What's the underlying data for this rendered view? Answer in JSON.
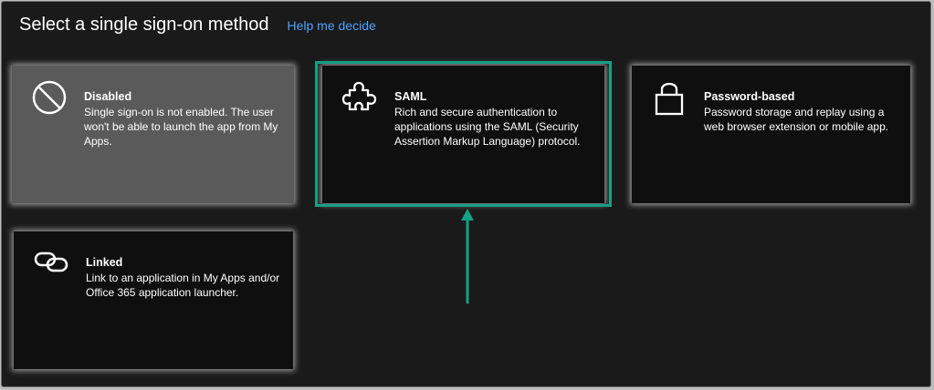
{
  "header": {
    "title": "Select a single sign-on method",
    "help_link": "Help me decide"
  },
  "cards": {
    "disabled": {
      "title": "Disabled",
      "description": "Single sign-on is not enabled. The user won't be able to launch the app from My Apps.",
      "icon": "disabled-icon"
    },
    "saml": {
      "title": "SAML",
      "description": "Rich and secure authentication to applications using the SAML (Security Assertion Markup Language) protocol.",
      "icon": "puzzle-icon"
    },
    "password": {
      "title": "Password-based",
      "description": "Password storage and replay using a web browser extension or mobile app.",
      "icon": "lock-icon"
    },
    "linked": {
      "title": "Linked",
      "description": "Link to an application in My Apps and/or Office 365 application launcher.",
      "icon": "link-icon"
    }
  },
  "colors": {
    "highlight": "#14a085",
    "link": "#4ea1ff",
    "background": "#1a1a1a",
    "disabled_card": "#5a5a5a"
  }
}
